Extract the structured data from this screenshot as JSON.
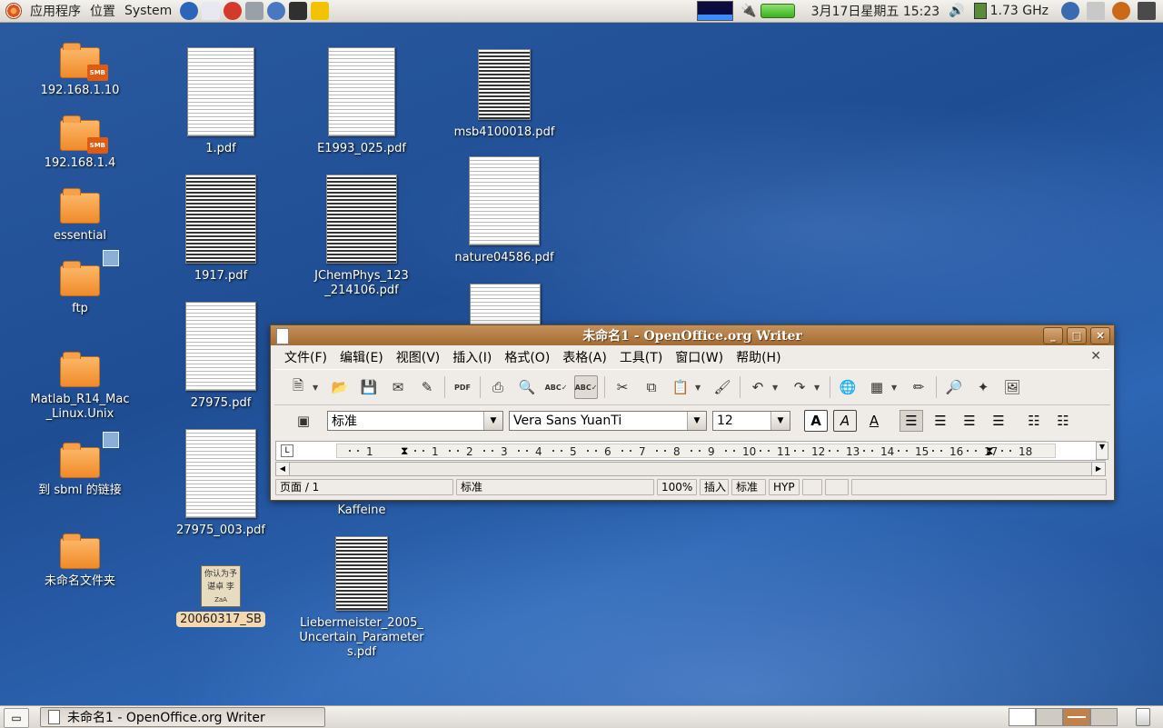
{
  "top_panel": {
    "menus": [
      "应用程序",
      "位置",
      "System"
    ],
    "launchers": [
      {
        "icon": "web-browser-icon",
        "color": "#2b64b8"
      },
      {
        "icon": "mail-icon",
        "color": "#e8e8f0"
      },
      {
        "icon": "help-lifebuoy-icon",
        "color": "#d23a2a"
      },
      {
        "icon": "screenshot-icon",
        "color": "#9aa0a8"
      },
      {
        "icon": "network-globe-icon",
        "color": "#4a78c0"
      },
      {
        "icon": "terminal-icon",
        "color": "#303030"
      },
      {
        "icon": "warning-icon",
        "color": "#f2c400"
      }
    ],
    "clock": "3月17日星期五 15:23",
    "cpu_freq": "1.73 GHz"
  },
  "desktop_icons": [
    {
      "label": "192.168.1.10",
      "kind": "network-share-folder",
      "badge": "SMB"
    },
    {
      "label": "192.168.1.4",
      "kind": "network-share-folder",
      "badge": "SMB"
    },
    {
      "label": "essential",
      "kind": "folder"
    },
    {
      "label": "ftp",
      "kind": "folder-link"
    },
    {
      "label": "Matlab_R14_Mac_Linux.Unix",
      "kind": "folder"
    },
    {
      "label": "到 sbml 的链接",
      "kind": "folder-link"
    },
    {
      "label": "未命名文件夹",
      "kind": "folder"
    },
    {
      "label": "1.pdf",
      "kind": "pdf"
    },
    {
      "label": "1917.pdf",
      "kind": "pdf"
    },
    {
      "label": "27975.pdf",
      "kind": "pdf"
    },
    {
      "label": "27975_003.pdf",
      "kind": "pdf"
    },
    {
      "label": "20060317_SB",
      "kind": "image",
      "selected": true,
      "thumb_lines": [
        "你认为予",
        "谌卓 李",
        "ZaA"
      ]
    },
    {
      "label": "E1993_025.pdf",
      "kind": "pdf"
    },
    {
      "label": "JChemPhys_123_214106.pdf",
      "kind": "pdf"
    },
    {
      "label": "Kaffeine",
      "kind": "application"
    },
    {
      "label": "Liebermeister_2005_Uncertain_Parameters.pdf",
      "kind": "pdf"
    },
    {
      "label": "msb4100018.pdf",
      "kind": "pdf"
    },
    {
      "label": "nature04586.pdf",
      "kind": "pdf"
    }
  ],
  "window": {
    "title": "未命名1 - OpenOffice.org Writer",
    "menu": [
      "文件(F)",
      "编辑(E)",
      "视图(V)",
      "插入(I)",
      "格式(O)",
      "表格(A)",
      "工具(T)",
      "窗口(W)",
      "帮助(H)"
    ],
    "toolbar": [
      {
        "icon": "new-document-icon",
        "glyph": "🗎",
        "dropdown": true
      },
      {
        "icon": "open-folder-icon",
        "glyph": "📂"
      },
      {
        "icon": "save-icon",
        "glyph": "💾"
      },
      {
        "icon": "email-icon",
        "glyph": "✉"
      },
      {
        "icon": "edit-file-icon",
        "glyph": "✎"
      },
      {
        "icon": "export-pdf-icon",
        "glyph": "PDF"
      },
      {
        "icon": "print-icon",
        "glyph": "⎙"
      },
      {
        "icon": "print-preview-icon",
        "glyph": "🔍"
      },
      {
        "icon": "spellcheck-icon",
        "glyph": "ABC✓"
      },
      {
        "icon": "autospellcheck-icon",
        "glyph": "ABC✓",
        "active": true
      },
      {
        "icon": "cut-icon",
        "glyph": "✂"
      },
      {
        "icon": "copy-icon",
        "glyph": "⧉"
      },
      {
        "icon": "paste-icon",
        "glyph": "📋",
        "dropdown": true
      },
      {
        "icon": "format-paintbrush-icon",
        "glyph": "🖌"
      },
      {
        "icon": "undo-icon",
        "glyph": "↶",
        "dropdown": true
      },
      {
        "icon": "redo-icon",
        "glyph": "↷",
        "dropdown": true
      },
      {
        "icon": "hyperlink-icon",
        "glyph": "🌐"
      },
      {
        "icon": "table-icon",
        "glyph": "▦",
        "dropdown": true
      },
      {
        "icon": "show-draw-functions-icon",
        "glyph": "✏"
      },
      {
        "icon": "find-replace-icon",
        "glyph": "🔎"
      },
      {
        "icon": "navigator-icon",
        "glyph": "✦"
      },
      {
        "icon": "gallery-icon",
        "glyph": "🖼"
      }
    ],
    "style_combo": "标准",
    "font_combo": "Vera Sans YuanTi",
    "size_combo": "12",
    "format_buttons": [
      {
        "icon": "bold-icon",
        "glyph": "A"
      },
      {
        "icon": "italic-icon",
        "glyph": "A"
      },
      {
        "icon": "underline-icon",
        "glyph": "A"
      }
    ],
    "align_buttons": [
      {
        "icon": "align-left-icon",
        "glyph": "☰",
        "pressed": true
      },
      {
        "icon": "align-center-icon",
        "glyph": "☰"
      },
      {
        "icon": "align-right-icon",
        "glyph": "☰"
      },
      {
        "icon": "justify-icon",
        "glyph": "☰"
      },
      {
        "icon": "numbering-icon",
        "glyph": "☷"
      },
      {
        "icon": "bullets-icon",
        "glyph": "☷"
      }
    ],
    "ruler_labels": [
      "1",
      "1",
      "2",
      "3",
      "4",
      "5",
      "6",
      "7",
      "8",
      "9",
      "10",
      "11",
      "12",
      "13",
      "14",
      "15",
      "16",
      "17",
      "18"
    ],
    "status": {
      "page": "页面 / 1",
      "style": "标准",
      "zoom": "100%",
      "insert": "插入",
      "selection": "标准",
      "hyphen": "HYP"
    }
  },
  "bottom_panel": {
    "task": "未命名1 - OpenOffice.org Writer"
  }
}
